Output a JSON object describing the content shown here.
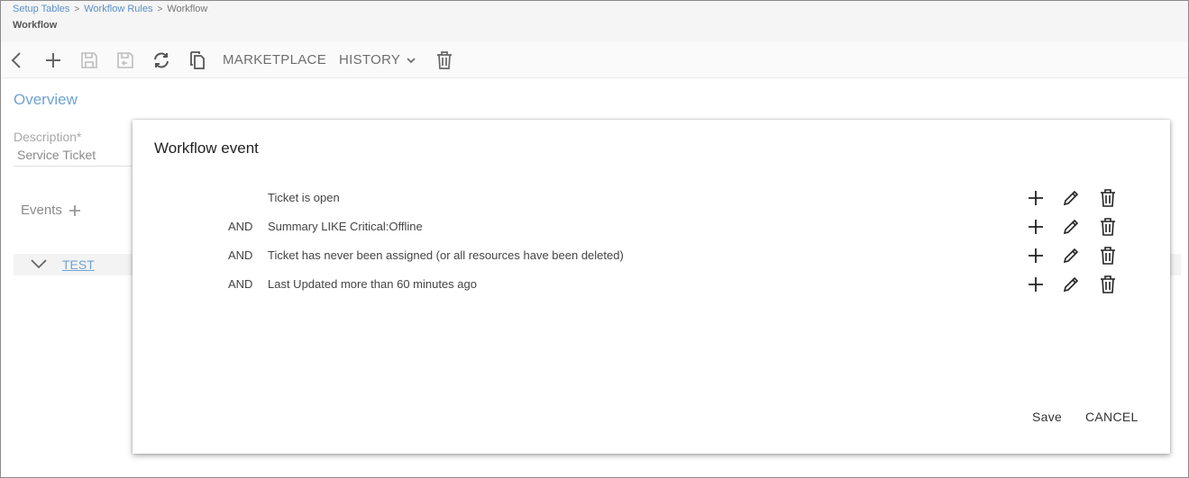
{
  "breadcrumb": {
    "items": [
      "Setup Tables",
      "Workflow Rules",
      "Workflow"
    ]
  },
  "page": {
    "title": "Workflow"
  },
  "toolbar": {
    "icons": [
      "back-icon",
      "add-icon",
      "save-icon",
      "save-close-icon",
      "refresh-icon",
      "copy-icon",
      "trash-icon"
    ],
    "marketplace_label": "MARKETPLACE",
    "history_label": "HISTORY"
  },
  "overview": {
    "heading": "Overview",
    "description_label": "Description*",
    "description_value": "Service Ticket",
    "events_label": "Events",
    "event_name": "TEST"
  },
  "modal": {
    "title": "Workflow event",
    "conditions": [
      {
        "operator": "",
        "text": "Ticket is open"
      },
      {
        "operator": "AND",
        "text": "Summary LIKE Critical:Offline"
      },
      {
        "operator": "AND",
        "text": "Ticket has never been assigned (or all resources have been deleted)"
      },
      {
        "operator": "AND",
        "text": "Last Updated more than 60 minutes ago"
      }
    ],
    "save_label": "Save",
    "cancel_label": "CANCEL"
  },
  "colors": {
    "accent": "#6fa2d3",
    "toolbar_text": "#6e6e6e"
  }
}
